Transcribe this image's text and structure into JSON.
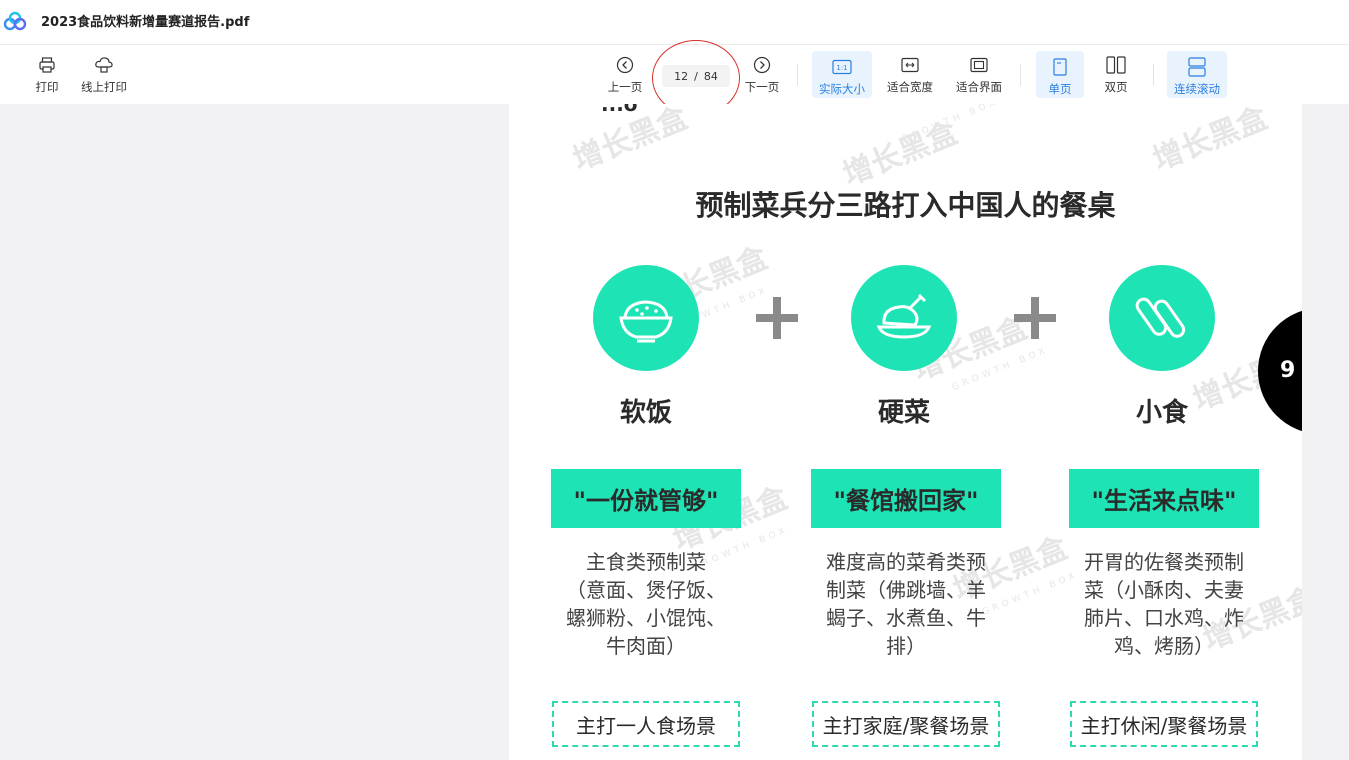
{
  "title_bar": {
    "file_name": "2023食品饮料新增量赛道报告.pdf"
  },
  "toolbar": {
    "left_partial_label": "：",
    "print_label": "打印",
    "online_print_label": "线上打印",
    "prev_page_label": "上一页",
    "next_page_label": "下一页",
    "current_page": "12",
    "page_separator": "/",
    "total_pages": "84",
    "actual_size_label": "实际大小",
    "fit_width_label": "适合宽度",
    "fit_page_label": "适合界面",
    "single_page_label": "单页",
    "double_page_label": "双页",
    "continuous_scroll_label": "连续滚动",
    "actual_size_icon_text": "1:1"
  },
  "colors": {
    "accent": "#2a7fe0",
    "mint": "#1ee3b5",
    "annotation": "#d9312b"
  },
  "document_page": {
    "top_cut_text": "...o",
    "heading": "预制菜兵分三路打入中国人的餐桌",
    "page_badge": "9",
    "watermark_cn": "增长黑盒",
    "watermark_en": "GROWTH BOX",
    "columns": [
      {
        "icon": "rice-bowl-icon",
        "category": "软饭",
        "slogan": "\"一份就管够\"",
        "desc_lines": [
          "主食类预制菜",
          "（意面、煲仔饭、",
          "螺狮粉、小馄饨、",
          "牛肉面）"
        ],
        "scene": "主打一人食场景"
      },
      {
        "icon": "roast-chicken-icon",
        "category": "硬菜",
        "slogan": "\"餐馆搬回家\"",
        "desc_lines": [
          "难度高的菜肴类预",
          "制菜（佛跳墙、羊",
          "蝎子、水煮鱼、牛",
          "排）"
        ],
        "scene": "主打家庭/聚餐场景"
      },
      {
        "icon": "sausage-icon",
        "category": "小食",
        "slogan": "\"生活来点味\"",
        "desc_lines": [
          "开胃的佐餐类预制",
          "菜（小酥肉、夫妻",
          "肺片、口水鸡、炸",
          "鸡、烤肠）"
        ],
        "scene": "主打休闲/聚餐场景"
      }
    ]
  }
}
